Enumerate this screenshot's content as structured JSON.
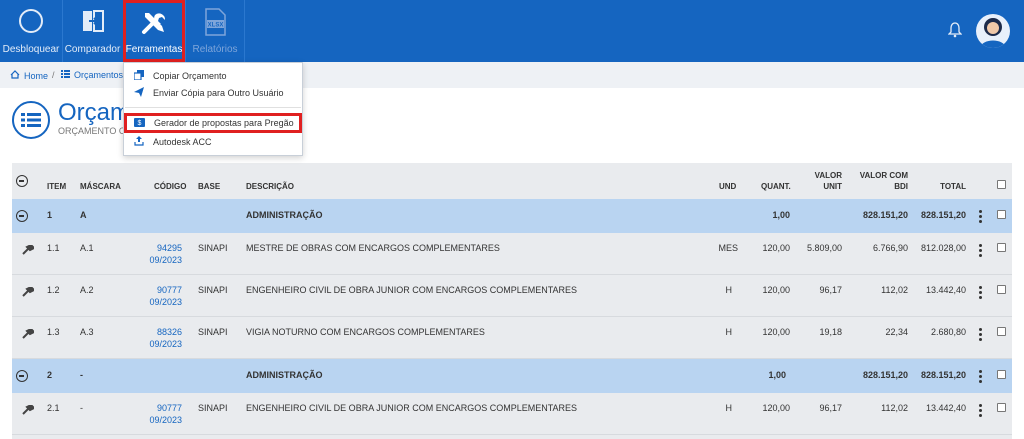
{
  "topbar": {
    "buttons": [
      {
        "label": "Desbloquear",
        "icon": "circle-icon"
      },
      {
        "label": "Comparador",
        "icon": "compare-icon"
      },
      {
        "label": "Ferramentas",
        "icon": "tools-icon"
      },
      {
        "label": "Relatórios",
        "icon": "xlsx-file-icon",
        "badge": "XLSX"
      }
    ]
  },
  "breadcrumb": {
    "home": "Home",
    "current": "Orçamentos"
  },
  "page": {
    "title": "Orçamento",
    "subtitle": "ORÇAMENTO OFICIAL"
  },
  "dropdown": {
    "items": [
      "Copiar Orçamento",
      "Enviar Cópia para Outro Usuário",
      "Gerador de propostas para Pregão",
      "Autodesk ACC"
    ]
  },
  "table": {
    "headers": {
      "item": "ITEM",
      "mascara": "MÁSCARA",
      "codigo": "CÓDIGO",
      "base": "BASE",
      "descricao": "DESCRIÇÃO",
      "und": "UND",
      "quant": "QUANT.",
      "valor_unit_1": "VALOR",
      "valor_unit_2": "UNIT",
      "valor_bdi_1": "VALOR COM",
      "valor_bdi_2": "BDI",
      "total": "TOTAL"
    },
    "rows": [
      {
        "item": "1",
        "mascara": "A",
        "descricao": "ADMINISTRAÇÃO",
        "quant": "1,00",
        "bdi": "828.151,20",
        "total": "828.151,20"
      },
      {
        "item": "1.1",
        "mascara": "A.1",
        "codigo": "94295",
        "data": "09/2023",
        "base": "SINAPI",
        "descricao": "MESTRE DE OBRAS COM ENCARGOS COMPLEMENTARES",
        "und": "MES",
        "quant": "120,00",
        "unit": "5.809,00",
        "bdi": "6.766,90",
        "total": "812.028,00"
      },
      {
        "item": "1.2",
        "mascara": "A.2",
        "codigo": "90777",
        "data": "09/2023",
        "base": "SINAPI",
        "descricao": "ENGENHEIRO CIVIL DE OBRA JUNIOR COM ENCARGOS COMPLEMENTARES",
        "und": "H",
        "quant": "120,00",
        "unit": "96,17",
        "bdi": "112,02",
        "total": "13.442,40"
      },
      {
        "item": "1.3",
        "mascara": "A.3",
        "codigo": "88326",
        "data": "09/2023",
        "base": "SINAPI",
        "descricao": "VIGIA NOTURNO COM ENCARGOS COMPLEMENTARES",
        "und": "H",
        "quant": "120,00",
        "unit": "19,18",
        "bdi": "22,34",
        "total": "2.680,80"
      },
      {
        "item": "2",
        "mascara": "-",
        "descricao": "ADMINISTRAÇÃO",
        "quant": "1,00",
        "bdi": "828.151,20",
        "total": "828.151,20"
      },
      {
        "item": "2.1",
        "mascara": "-",
        "codigo": "90777",
        "data": "09/2023",
        "base": "SINAPI",
        "descricao": "ENGENHEIRO CIVIL DE OBRA JUNIOR COM ENCARGOS COMPLEMENTARES",
        "und": "H",
        "quant": "120,00",
        "unit": "96,17",
        "bdi": "112,02",
        "total": "13.442,40"
      }
    ]
  },
  "colors": {
    "primary": "#1565c0",
    "group_row": "#b9d4f1",
    "highlight": "#e02020"
  }
}
